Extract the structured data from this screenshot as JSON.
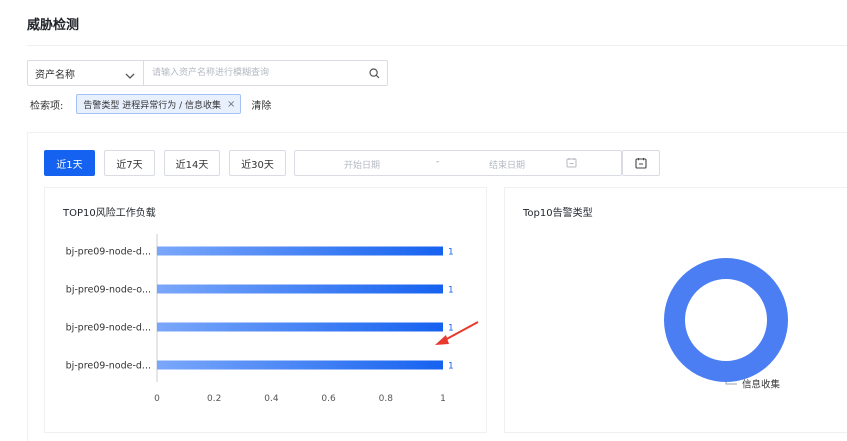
{
  "page": {
    "title": "威胁检测"
  },
  "search": {
    "select_label": "资产名称",
    "placeholder": "请输入资产名称进行模糊查询",
    "value": ""
  },
  "filters": {
    "label": "检索项:",
    "tags": [
      {
        "text": "告警类型  进程异常行为 / 信息收集"
      }
    ],
    "clear_label": "清除"
  },
  "time_range": {
    "buttons": [
      {
        "label": "近1天",
        "active": true
      },
      {
        "label": "近7天",
        "active": false
      },
      {
        "label": "近14天",
        "active": false
      },
      {
        "label": "近30天",
        "active": false
      }
    ],
    "start_placeholder": "开始日期",
    "separator": "-",
    "end_placeholder": "结束日期"
  },
  "colors": {
    "primary": "#1662f0",
    "bar_start": "#7aa7fa",
    "bar_end": "#1662f0",
    "donut": "#4b7ef2",
    "annotation_arrow": "#e8392f"
  },
  "chart_data": [
    {
      "type": "bar",
      "orientation": "horizontal",
      "title": "TOP10风险工作负载",
      "categories": [
        "bj-pre09-node-d...",
        "bj-pre09-node-o...",
        "bj-pre09-node-d...",
        "bj-pre09-node-d..."
      ],
      "values": [
        1,
        1,
        1,
        1
      ],
      "data_labels": [
        "1",
        "1",
        "1",
        "1"
      ],
      "xlim": [
        0,
        1
      ],
      "x_ticks": [
        "0",
        "0.2",
        "0.4",
        "0.6",
        "0.8",
        "1"
      ],
      "grid": false
    },
    {
      "type": "pie",
      "style": "donut",
      "title": "Top10告警类型",
      "categories": [
        "信息收集"
      ],
      "values": [
        1
      ]
    }
  ]
}
